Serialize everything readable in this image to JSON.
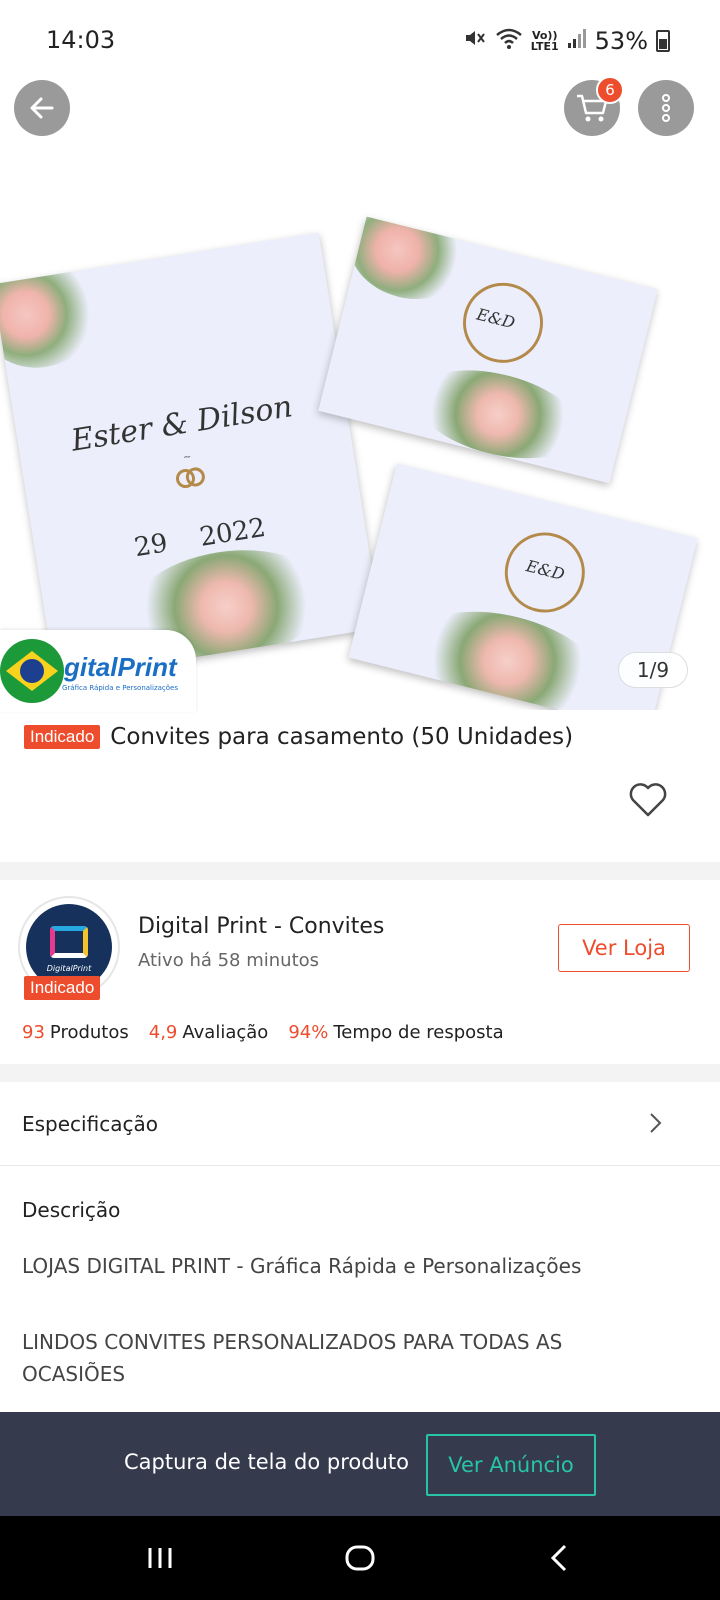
{
  "status_bar": {
    "time": "14:03",
    "network_top": "Vo))",
    "network_bottom": "LTE1",
    "battery": "53%"
  },
  "header": {
    "cart_count": "6"
  },
  "gallery": {
    "page_counter": "1/9",
    "store_logo_text": "gitalPrint",
    "store_logo_sub": "Gráfica Rápida e Personalizações",
    "invitation": {
      "names": "Ester & Dilson",
      "date_day": "29",
      "date_year": "2022",
      "monogram": "E&D"
    }
  },
  "product": {
    "badge": "Indicado",
    "title": "Convites para casamento (50 Unidades)"
  },
  "shop": {
    "name": "Digital Print - Convites",
    "active": "Ativo há 58 minutos",
    "badge": "Indicado",
    "avatar_text": "DigitalPrint",
    "ver_loja": "Ver Loja",
    "stats": [
      {
        "value": "93",
        "label": "Produtos"
      },
      {
        "value": "4,9",
        "label": "Avaliação"
      },
      {
        "value": "94%",
        "label": "Tempo de resposta"
      }
    ]
  },
  "sections": {
    "spec": "Especificação",
    "desc": "Descrição",
    "desc_lines": [
      "LOJAS DIGITAL PRINT - Gráfica Rápida e Personalizações",
      "LINDOS CONVITES PERSONALIZADOS PARA TODAS AS",
      "OCASIÕES"
    ]
  },
  "bottom_bar": {
    "text": "Captura de tela do produto",
    "button": "Ver Anúncio"
  },
  "colors": {
    "accent": "#ee4d2d",
    "teal": "#27c4a8",
    "bottom_bar": "#2d3246"
  }
}
